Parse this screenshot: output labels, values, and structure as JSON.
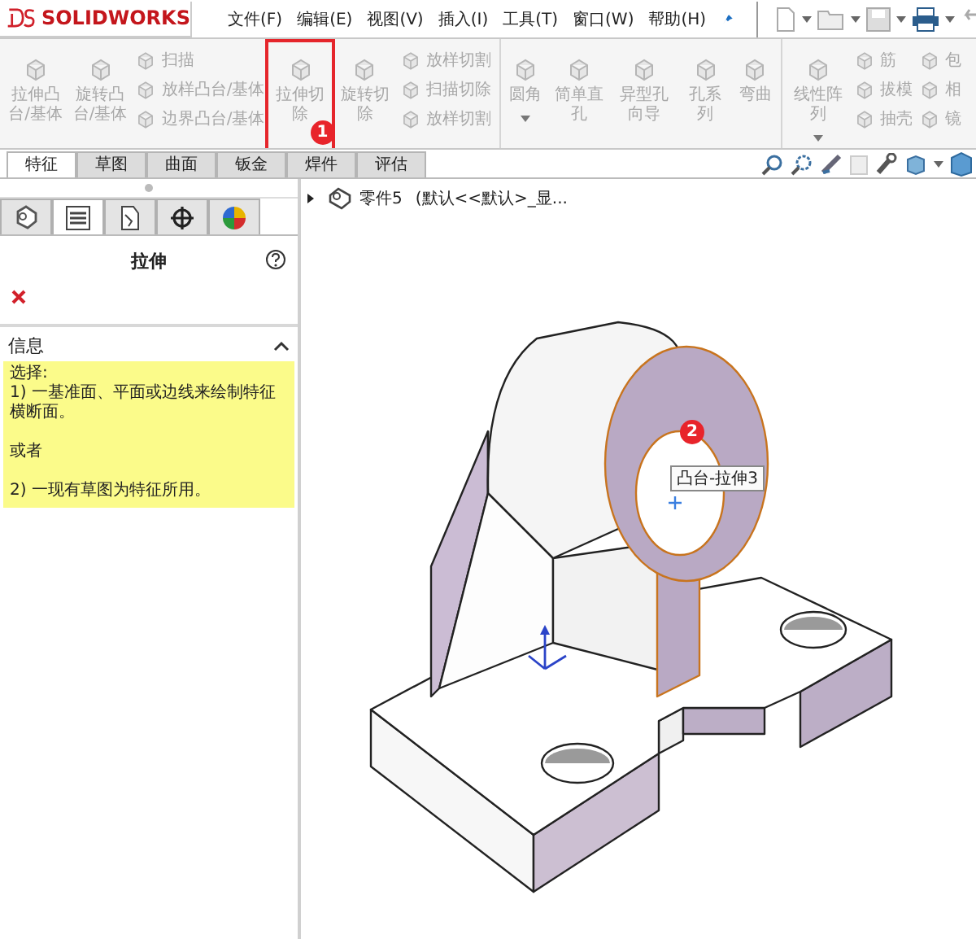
{
  "app": {
    "logo": "SOLIDWORKS"
  },
  "menu": [
    "文件(F)",
    "编辑(E)",
    "视图(V)",
    "插入(I)",
    "工具(T)",
    "窗口(W)",
    "帮助(H)"
  ],
  "ribbon": [
    {
      "items": [
        {
          "kind": "large",
          "label": "拉伸凸台/基体",
          "disabled": true
        },
        {
          "kind": "large",
          "label": "旋转凸台/基体",
          "disabled": true
        },
        {
          "kind": "stack",
          "items": [
            {
              "label": "扫描",
              "disabled": true
            },
            {
              "label": "放样凸台/基体",
              "disabled": true
            },
            {
              "label": "边界凸台/基体",
              "disabled": true
            }
          ]
        },
        {
          "kind": "large",
          "label": "拉伸切除",
          "disabled": true,
          "highlight": true,
          "badge": "1"
        },
        {
          "kind": "large",
          "label": "旋转切除",
          "disabled": true
        },
        {
          "kind": "stack",
          "items": [
            {
              "label": "放样切割",
              "disabled": true
            },
            {
              "label": "扫描切除",
              "disabled": true
            },
            {
              "label": "放样切割",
              "disabled": true
            }
          ]
        }
      ]
    },
    {
      "items": [
        {
          "kind": "large",
          "label": "圆角",
          "disabled": true,
          "dropdown": true
        },
        {
          "kind": "large",
          "label": "简单直孔",
          "disabled": true
        },
        {
          "kind": "large",
          "label": "异型孔向导",
          "disabled": true
        },
        {
          "kind": "large",
          "label": "孔系列",
          "disabled": true
        },
        {
          "kind": "large",
          "label": "弯曲",
          "disabled": true
        }
      ]
    },
    {
      "items": [
        {
          "kind": "large",
          "label": "线性阵列",
          "disabled": true,
          "dropdown": true
        },
        {
          "kind": "stack",
          "items": [
            {
              "label": "筋",
              "disabled": true
            },
            {
              "label": "拔模",
              "disabled": true
            },
            {
              "label": "抽壳",
              "disabled": true
            }
          ]
        },
        {
          "kind": "stack",
          "items": [
            {
              "label": "包",
              "disabled": true
            },
            {
              "label": "相",
              "disabled": true
            },
            {
              "label": "镜",
              "disabled": true
            }
          ]
        }
      ]
    }
  ],
  "tabs": [
    {
      "label": "特征",
      "selected": true
    },
    {
      "label": "草图",
      "selected": false
    },
    {
      "label": "曲面",
      "selected": false
    },
    {
      "label": "钣金",
      "selected": false
    },
    {
      "label": "焊件",
      "selected": false
    },
    {
      "label": "评估",
      "selected": false
    }
  ],
  "panel_tabs": [
    {
      "kind": "tree",
      "selected": false
    },
    {
      "kind": "property",
      "selected": true
    },
    {
      "kind": "config",
      "selected": false
    },
    {
      "kind": "crosshair",
      "selected": false
    },
    {
      "kind": "display",
      "selected": false
    }
  ],
  "property_manager": {
    "title": "拉伸",
    "section": "信息",
    "expanded": true,
    "message": [
      "选择:",
      "1) 一基准面、平面或边线来绘制特征横断面。",
      "或者",
      "2) 一现有草图为特征所用。"
    ]
  },
  "tree": {
    "part": "零件5",
    "config": "(默认<<默认>_显..."
  },
  "viewport": {
    "tooltip": "凸台-拉伸3",
    "badge": "2"
  }
}
